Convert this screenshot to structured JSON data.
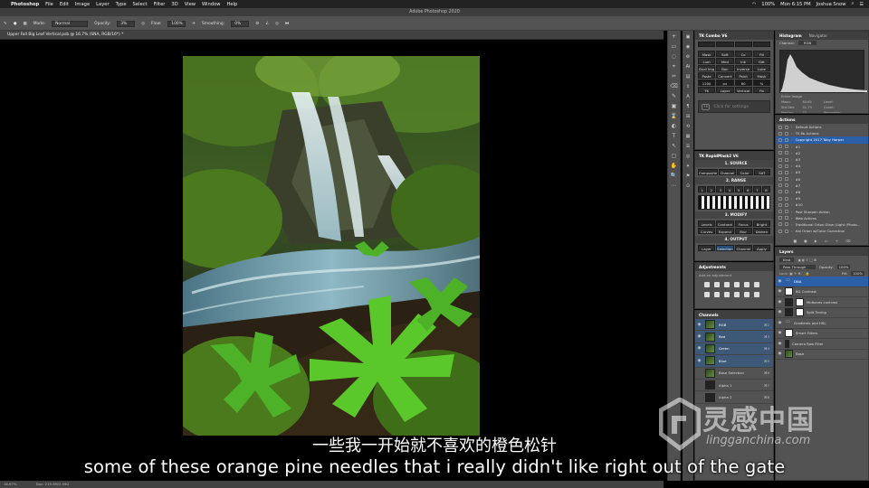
{
  "menubar": {
    "apple": "",
    "items": [
      "Photoshop",
      "File",
      "Edit",
      "Image",
      "Layer",
      "Type",
      "Select",
      "Filter",
      "3D",
      "View",
      "Window",
      "Help"
    ],
    "clock": "Mon 6:15 PM",
    "user": "Joshua Snow",
    "battery": "100%"
  },
  "window": {
    "title": "Adobe Photoshop 2020"
  },
  "options": {
    "mode_label": "Mode:",
    "mode_value": "Normal",
    "opacity_label": "Opacity:",
    "opacity_value": "3%",
    "flow_label": "Flow:",
    "flow_value": "100%",
    "smoothing_label": "Smoothing:",
    "smoothing_value": "0%"
  },
  "document": {
    "tab": "Upper Fall Big Leaf Vertical.psb @ 16.7% (SNA, RGB/16*) *"
  },
  "status": {
    "zoom": "16.67%",
    "info": "Doc: 219.5M/2.09G"
  },
  "toolstrip": [
    "+",
    "▭",
    "◌",
    "⌖",
    "✂",
    "⌫",
    "✎",
    "▣",
    "⌛",
    "◐",
    "T",
    "↖",
    "▢",
    "✋",
    "🔍",
    "⋯"
  ],
  "toolstrip2": [
    "▣",
    "◉",
    "⚙",
    "Ai",
    "▤",
    "⇧",
    "A",
    "¶",
    "⊞",
    "⟲",
    "▦",
    "☰",
    "◎",
    "✦",
    "⚑",
    "⊙"
  ],
  "tk": {
    "title": "TK Combo V6",
    "row1": [
      "Mask",
      "Soft",
      "Co",
      "Fill"
    ],
    "row2": [
      "Lum",
      "Med",
      "Ink",
      "Gdt"
    ],
    "row3": [
      "Dual Img",
      "Bon",
      "Inverse",
      "Luke"
    ],
    "row4": [
      "Paste",
      "Convert",
      "Paint",
      "Mask"
    ],
    "row5": [
      "1200",
      "px",
      "60",
      "%"
    ],
    "row6": [
      "TK",
      "Layer",
      "Vertical",
      "Fix"
    ],
    "click_text": "Click for settings"
  },
  "tk2": {
    "title": "TK RapidMask2 V6",
    "source": "1. SOURCE",
    "src_tabs": [
      "Composite",
      "Channel",
      "Color",
      "SAT"
    ],
    "range": "2. RANGE",
    "lights": [
      "L",
      "D",
      "M"
    ],
    "modify": "3. MODIFY",
    "mod_row1": [
      "Levels",
      "Contract",
      "Focus",
      "Bright"
    ],
    "mod_row2": [
      "Curves",
      "Expand",
      "Blur",
      "Darken"
    ],
    "output": "4. OUTPUT",
    "out_row": [
      "Layer",
      "Selection",
      "Channel",
      "Apply"
    ],
    "click_text": "Click for settings"
  },
  "histogram": {
    "tabs": [
      "Histogram",
      "Navigator"
    ],
    "channel_label": "Channel:",
    "channel_value": "RGB",
    "source": "Entire Image",
    "stats": [
      "Mean:",
      "83.65",
      "Level:",
      "",
      "Std Dev:",
      "41.73",
      "Count:",
      "",
      "Median:",
      "72",
      "Percentile:",
      "",
      "Pixels:",
      "560715",
      "Cache Level:",
      "4"
    ]
  },
  "actions": {
    "title": "Actions",
    "rows": [
      {
        "label": "Default Actions",
        "sel": false
      },
      {
        "label": "TK 6b Actions",
        "sel": false
      },
      {
        "label": "Copyright 2017 Toby Harper",
        "sel": true
      },
      {
        "label": "#1",
        "sel": false
      },
      {
        "label": "#2",
        "sel": false
      },
      {
        "label": "#3",
        "sel": false
      },
      {
        "label": "#4",
        "sel": false
      },
      {
        "label": "#5",
        "sel": false
      },
      {
        "label": "#6",
        "sel": false
      },
      {
        "label": "#7",
        "sel": false
      },
      {
        "label": "#8",
        "sel": false
      },
      {
        "label": "#9",
        "sel": false
      },
      {
        "label": "#10",
        "sel": false
      },
      {
        "label": "Post Sharpen Action",
        "sel": false
      },
      {
        "label": "Web Actions",
        "sel": false
      },
      {
        "label": "Traditional Orton Glow (Light (Photo...",
        "sel": false
      },
      {
        "label": "Hal Orton w/Color Correction",
        "sel": false
      }
    ]
  },
  "layers": {
    "title": "Layers",
    "kind": "Kind",
    "blend": "Pass Through",
    "opacity_label": "Opacity:",
    "opacity_value": "100%",
    "fill_label": "Fill:",
    "fill_value": "100%",
    "rows": [
      {
        "label": "DNA",
        "type": "folder",
        "sel": true
      },
      {
        "label": "BG Contrast",
        "type": "mask",
        "sel": false
      },
      {
        "label": "Midtones contrast",
        "type": "adj",
        "sel": false
      },
      {
        "label": "Split Toning",
        "type": "adj",
        "sel": false
      },
      {
        "label": "Gradients and HSL",
        "type": "folder",
        "sel": false
      },
      {
        "label": "Smart Filters",
        "type": "mask",
        "sel": false
      },
      {
        "label": "Camera Raw Filter",
        "type": "fx",
        "sel": false
      },
      {
        "label": "Base",
        "type": "img",
        "sel": false
      }
    ]
  },
  "adjustments": {
    "title": "Adjustments",
    "subtitle": "Add an adjustment"
  },
  "channels": {
    "title": "Channels",
    "rows": [
      {
        "label": "RGB",
        "shortcut": "⌘2",
        "sel": true
      },
      {
        "label": "Red",
        "shortcut": "⌘3",
        "sel": true
      },
      {
        "label": "Green",
        "shortcut": "⌘4",
        "sel": true
      },
      {
        "label": "Blue",
        "shortcut": "⌘5",
        "sel": true
      },
      {
        "label": "Base Selection",
        "shortcut": "⌘6",
        "sel": false
      },
      {
        "label": "Alpha 1",
        "shortcut": "⌘7",
        "sel": false
      },
      {
        "label": "Alpha 2",
        "shortcut": "⌘8",
        "sel": false
      }
    ]
  },
  "subtitles": {
    "cn": "一些我一开始就不喜欢的橙色松针",
    "en": "some of these orange pine needles that i really didn't like right out of the gate"
  },
  "watermark": {
    "cn": "灵感中国",
    "en": "lingganchina.com"
  }
}
